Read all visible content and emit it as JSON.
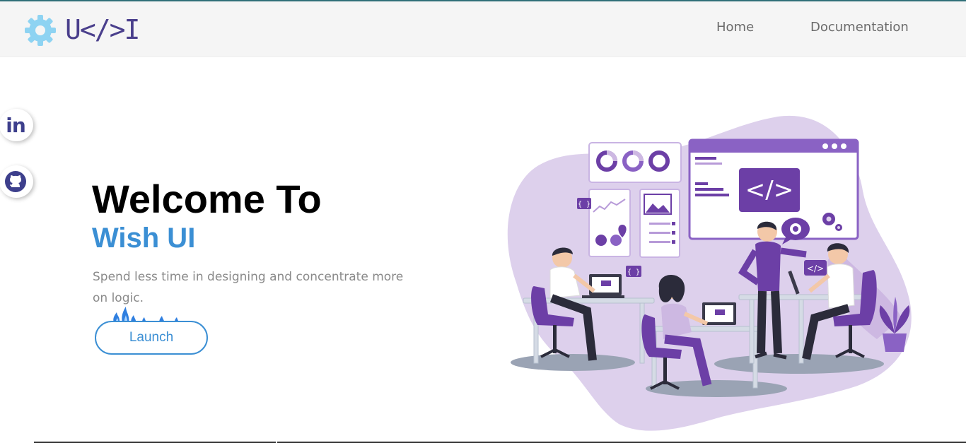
{
  "navbar": {
    "logo_text": "U</>I",
    "links": [
      {
        "label": "Home"
      },
      {
        "label": "Documentation"
      }
    ]
  },
  "social": [
    {
      "icon": "linkedin-icon",
      "glyph": "in"
    },
    {
      "icon": "github-icon"
    }
  ],
  "hero": {
    "title": "Welcome To",
    "subtitle": "Wish UI",
    "description": "Spend less time in designing and concentrate more on logic.",
    "launch_label": "Launch"
  },
  "illustration": {
    "code_symbol": "</>",
    "small_code_symbol": "</>",
    "brace_symbol": "{ }"
  },
  "colors": {
    "accent_blue": "#3b8fd4",
    "logo_purple": "#4a3f8c",
    "illustration_purple": "#6c3fa6",
    "blob_lavender": "#d9cbe9",
    "navbar_bg": "#f5f5f5"
  }
}
